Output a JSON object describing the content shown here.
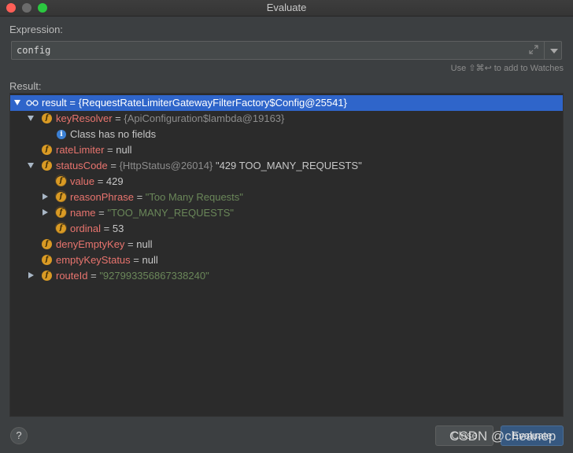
{
  "window": {
    "title": "Evaluate"
  },
  "expression": {
    "label": "Expression:",
    "value": "config",
    "hint": "Use ⇧⌘↩ to add to Watches"
  },
  "result": {
    "label": "Result:",
    "rows": [
      {
        "name": "result",
        "eq": " = ",
        "value": "{RequestRateLimiterGatewayFilterFactory$Config@25541}"
      },
      {
        "name": "keyResolver",
        "eq": " = ",
        "value": "{ApiConfiguration$lambda@19163}"
      },
      {
        "text": "Class has no fields"
      },
      {
        "name": "rateLimiter",
        "eq": " = ",
        "value": "null"
      },
      {
        "name": "statusCode",
        "eq": " = ",
        "type": "{HttpStatus@26014}",
        "value": "\"429 TOO_MANY_REQUESTS\""
      },
      {
        "name": "value",
        "eq": " = ",
        "value": "429"
      },
      {
        "name": "reasonPhrase",
        "eq": " = ",
        "value": "\"Too Many Requests\""
      },
      {
        "name": "name",
        "eq": " = ",
        "value": "\"TOO_MANY_REQUESTS\""
      },
      {
        "name": "ordinal",
        "eq": " = ",
        "value": "53"
      },
      {
        "name": "denyEmptyKey",
        "eq": " = ",
        "value": "null"
      },
      {
        "name": "emptyKeyStatus",
        "eq": " = ",
        "value": "null"
      },
      {
        "name": "routeId",
        "eq": " = ",
        "value": "\"927993356867338240\""
      }
    ]
  },
  "buttons": {
    "help": "?",
    "close": "Close",
    "evaluate": "Evaluate"
  },
  "watermark": "CSDN @cheanep",
  "colors": {
    "selection": "#2f65ca",
    "field_icon": "#d99a24",
    "string": "#6a8759",
    "field_name": "#e8746e"
  },
  "icons": [
    "close-icon",
    "minimize-icon",
    "maximize-icon",
    "expand-icon",
    "chevron-down-icon",
    "watch-glasses-icon",
    "field-icon",
    "info-icon",
    "help-icon"
  ]
}
